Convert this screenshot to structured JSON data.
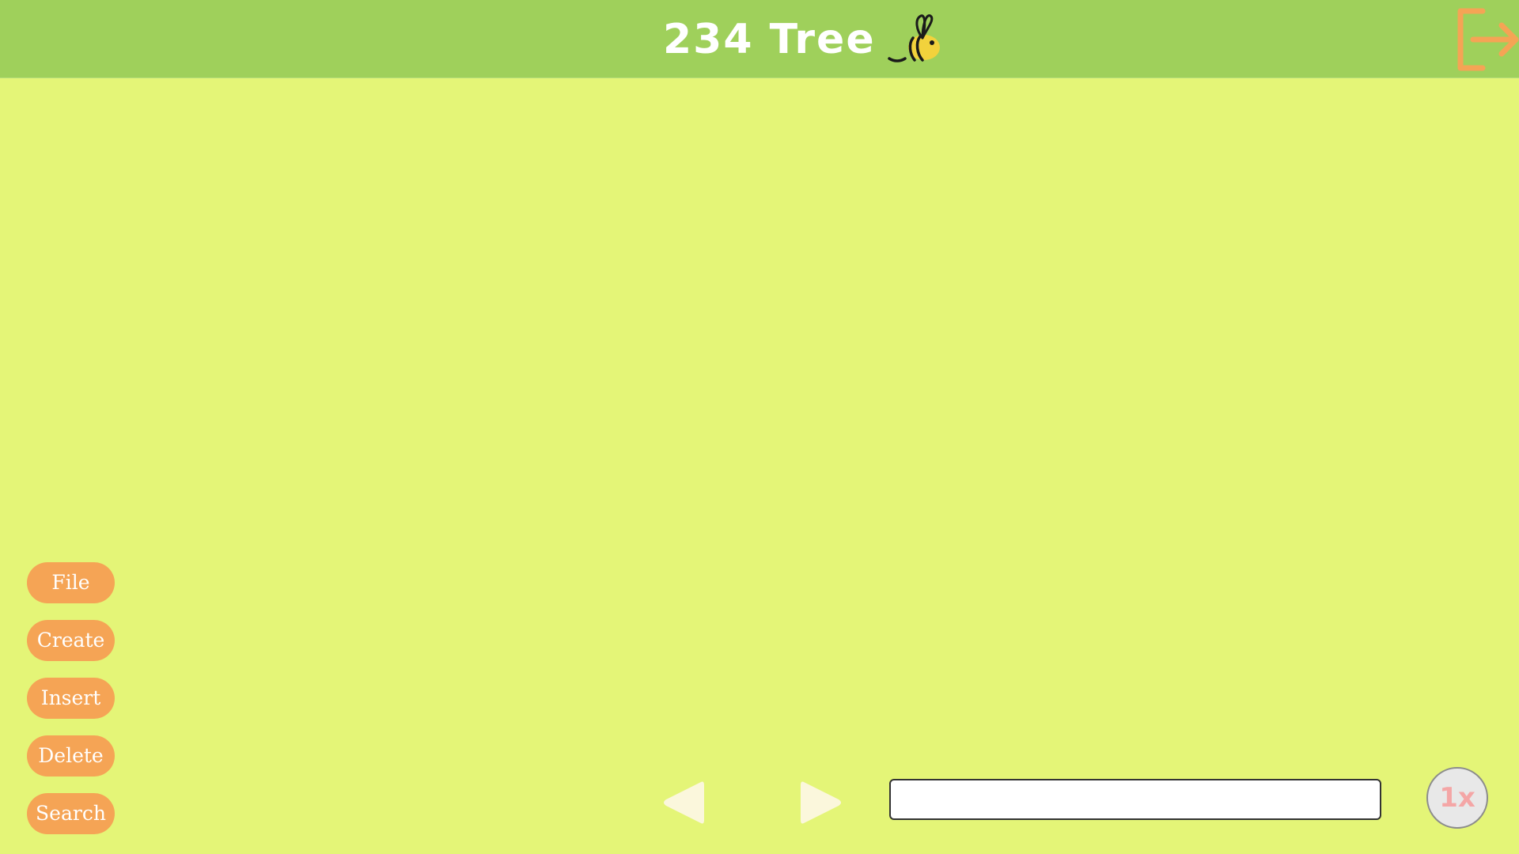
{
  "header": {
    "title": "234 Tree",
    "mascot_icon": "bee-icon",
    "exit_icon": "exit-icon",
    "colors": {
      "header_bg": "#9fd05b",
      "title": "#ffffff",
      "exit": "#f5a455"
    }
  },
  "canvas": {
    "background": "#e4f577"
  },
  "sidebar": {
    "buttons": [
      {
        "label": "File"
      },
      {
        "label": "Create"
      },
      {
        "label": "Insert"
      },
      {
        "label": "Delete"
      },
      {
        "label": "Search"
      }
    ],
    "button_color": "#f5a455"
  },
  "controls": {
    "prev_icon": "triangle-left-icon",
    "next_icon": "triangle-right-icon",
    "input_value": "",
    "input_placeholder": "",
    "speed_label": "1x",
    "speed_color": "#f4a6a6"
  }
}
